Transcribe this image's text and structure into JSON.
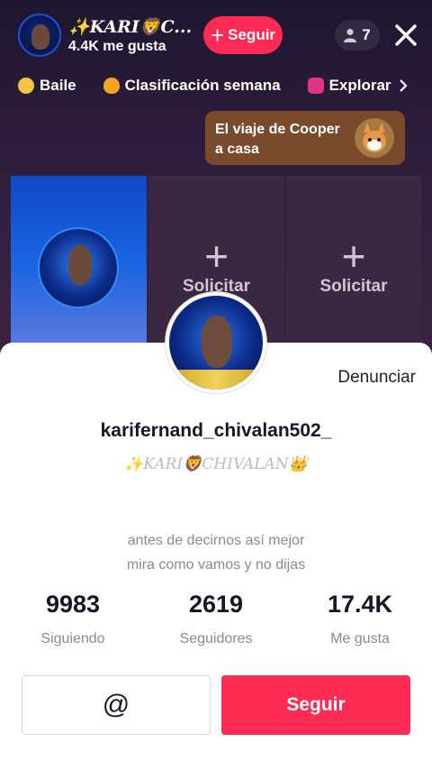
{
  "host": {
    "name": "✨KARI🦁C...",
    "likes": "4.4K me gusta",
    "follow_label": "Seguir",
    "viewers": "7"
  },
  "tags": [
    {
      "label": "Baile",
      "icon": "hashtag-icon",
      "color": "#f5c242"
    },
    {
      "label": "Clasificación semana",
      "icon": "flame-icon",
      "color": "#f5a623"
    },
    {
      "label": "Explorar",
      "icon": "explore-icon",
      "color": "#e0338a"
    }
  ],
  "promo": {
    "line1": "El viaje de Cooper",
    "line2": "a casa"
  },
  "slots": [
    {
      "label": ""
    },
    {
      "label": "Solicitar"
    },
    {
      "label": "Solicitar"
    }
  ],
  "profile": {
    "report_label": "Denunciar",
    "username": "karifernand_chivalan502_",
    "nickname": "✨KARI🦁CHIVALAN👑",
    "bio_line1": "antes de decirnos así mejor",
    "bio_line2": "mira como vamos y no dijas"
  },
  "stats": [
    {
      "value": "9983",
      "label": "Siguiendo"
    },
    {
      "value": "2619",
      "label": "Seguidores"
    },
    {
      "value": "17.4K",
      "label": "Me gusta"
    }
  ],
  "actions": {
    "mention_label": "@",
    "follow_label": "Seguir"
  },
  "colors": {
    "accent": "#fe2c55",
    "promo": "#7a4a2c"
  }
}
